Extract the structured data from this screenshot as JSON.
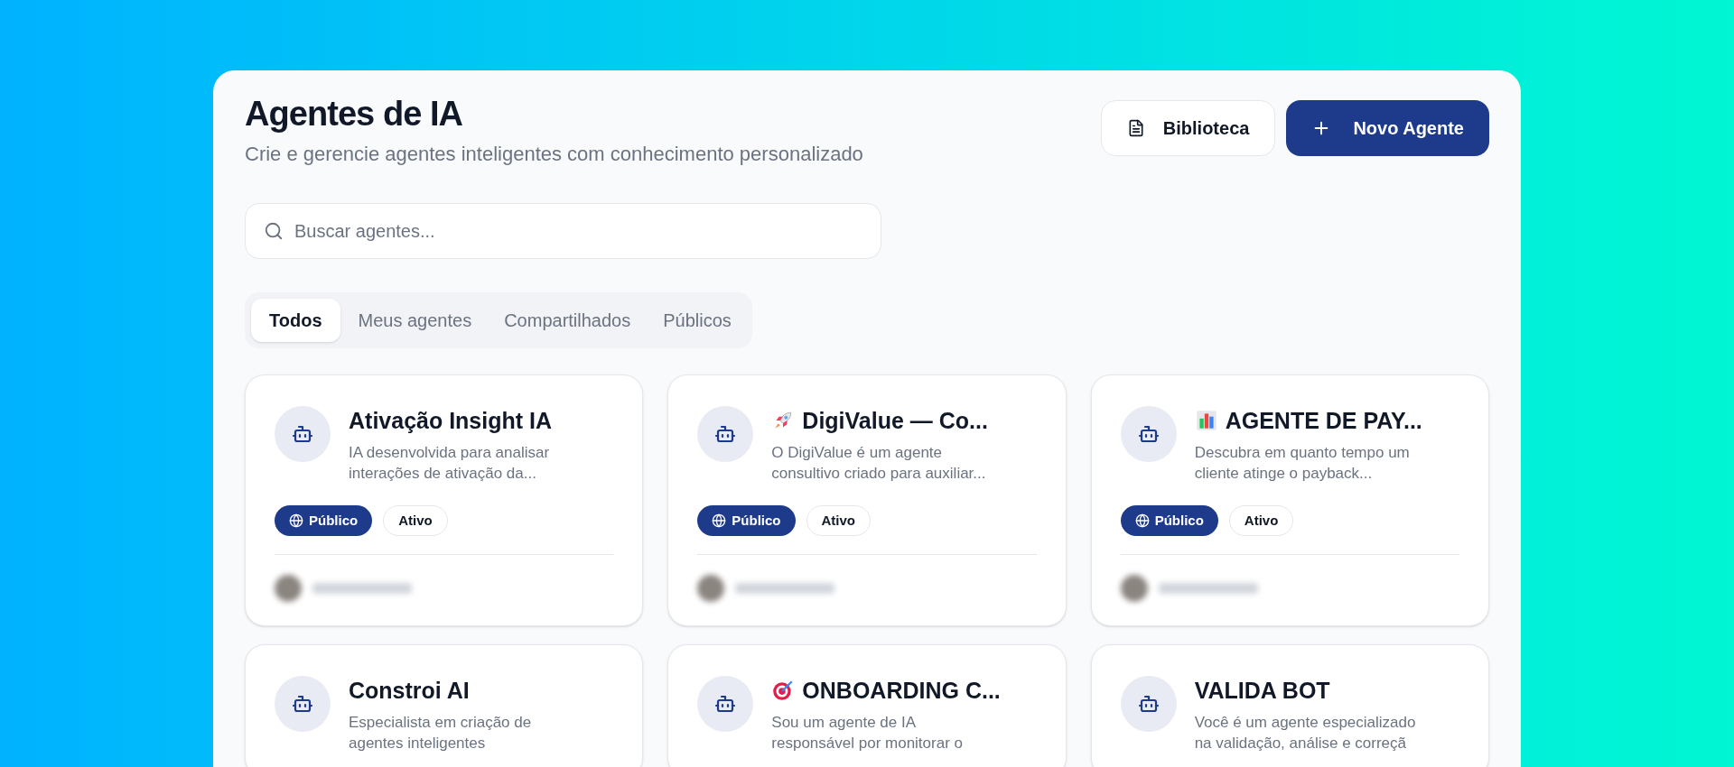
{
  "header": {
    "title": "Agentes de IA",
    "subtitle": "Crie e gerencie agentes inteligentes com conhecimento personalizado"
  },
  "actions": [
    {
      "kind": "secondary",
      "label": "Biblioteca"
    },
    {
      "kind": "primary",
      "label": "Novo Agente"
    }
  ],
  "search": {
    "placeholder": "Buscar agentes..."
  },
  "tabs": [
    {
      "label": "Todos",
      "selected": true
    },
    {
      "label": "Meus agentes",
      "selected": false
    },
    {
      "label": "Compartilhados",
      "selected": false
    },
    {
      "label": "Públicos",
      "selected": false
    }
  ],
  "agents": [
    {
      "name": "Ativação Insight IA",
      "description": [
        "IA desenvolvida para analisar",
        "interações de ativação da..."
      ],
      "badges": [
        {
          "kind": "visibility",
          "label": "Público"
        },
        {
          "kind": "status",
          "label": "Ativo"
        }
      ],
      "owner": {
        "kind": "blurred"
      }
    },
    {
      "emoji": {
        "kind": "rocket"
      },
      "name": "DigiValue — Co...",
      "description": [
        "O DigiValue é um agente",
        "consultivo criado para auxiliar..."
      ],
      "badges": [
        {
          "kind": "visibility",
          "label": "Público"
        },
        {
          "kind": "status",
          "label": "Ativo"
        }
      ],
      "owner": {
        "kind": "blurred"
      }
    },
    {
      "emoji": {
        "kind": "chart"
      },
      "name": "AGENTE DE PAY...",
      "description": [
        "Descubra em quanto tempo um",
        "cliente atinge o payback..."
      ],
      "badges": [
        {
          "kind": "visibility",
          "label": "Público"
        },
        {
          "kind": "status",
          "label": "Ativo"
        }
      ],
      "owner": {
        "kind": "blurred"
      }
    },
    {
      "name": "Constroi AI",
      "description": [
        "Especialista em criação de",
        "agentes inteligentes"
      ]
    },
    {
      "emoji": {
        "kind": "target"
      },
      "name": "ONBOARDING C...",
      "description": [
        "Sou um agente de IA",
        "responsável por monitorar o"
      ]
    },
    {
      "name": "VALIDA BOT",
      "description": [
        "Você é um agente especializado",
        "na validação, análise e correçã"
      ]
    }
  ]
}
